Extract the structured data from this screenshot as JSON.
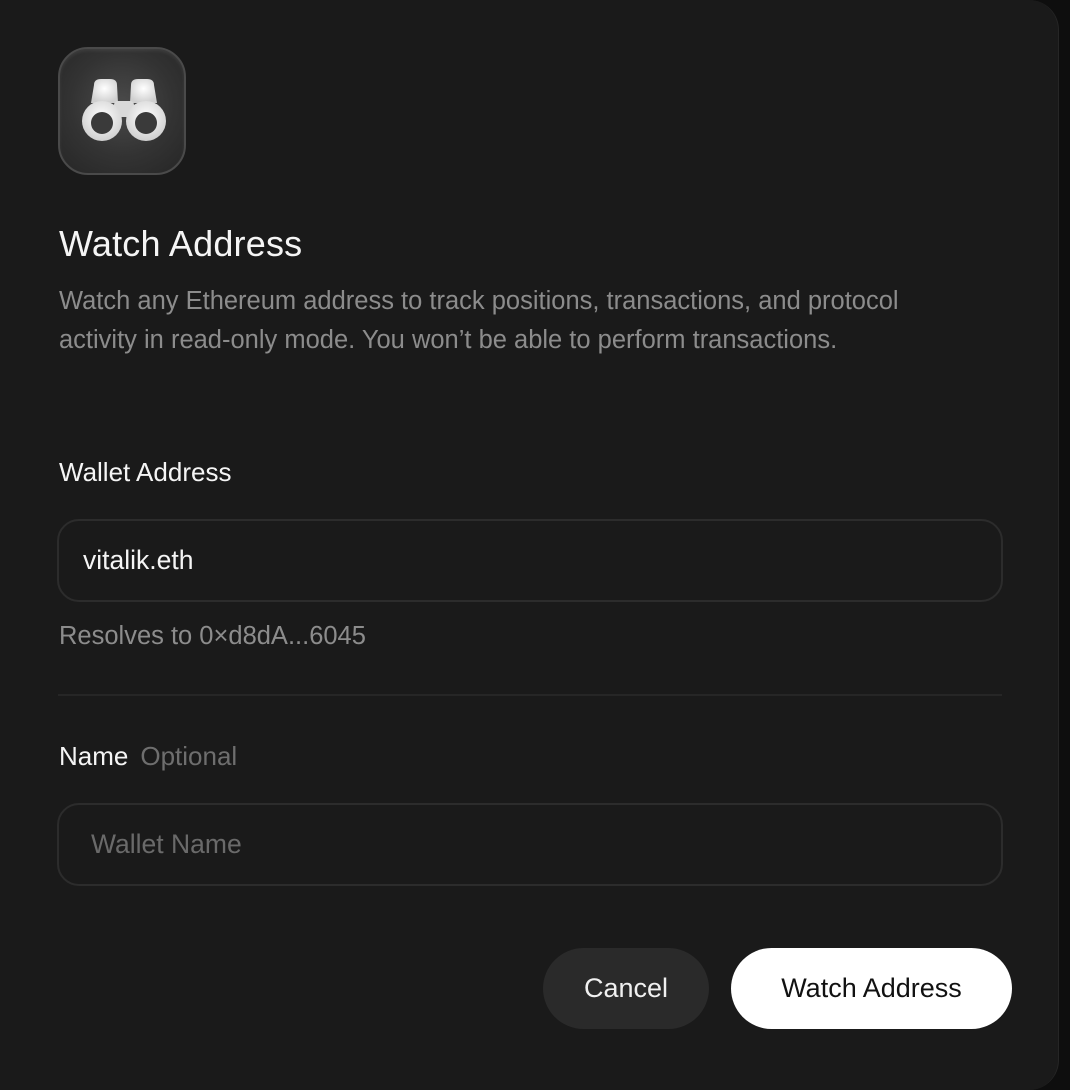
{
  "dialog": {
    "icon": "binoculars-icon",
    "title": "Watch Address",
    "description": "Watch any Ethereum address to track positions, transactions, and protocol activity in read-only mode. You won’t be able to perform transactions."
  },
  "wallet_field": {
    "label": "Wallet Address",
    "value": "vitalik.eth",
    "resolves_text": "Resolves to 0×d8dA...6045"
  },
  "name_field": {
    "label": "Name",
    "optional_tag": "Optional",
    "value": "",
    "placeholder": "Wallet Name"
  },
  "actions": {
    "cancel_label": "Cancel",
    "submit_label": "Watch Address"
  },
  "colors": {
    "background": "#1a1a1a",
    "primary_button": "#ffffff",
    "secondary_button": "#2a2a2a",
    "muted_text": "#8c8c8c"
  }
}
